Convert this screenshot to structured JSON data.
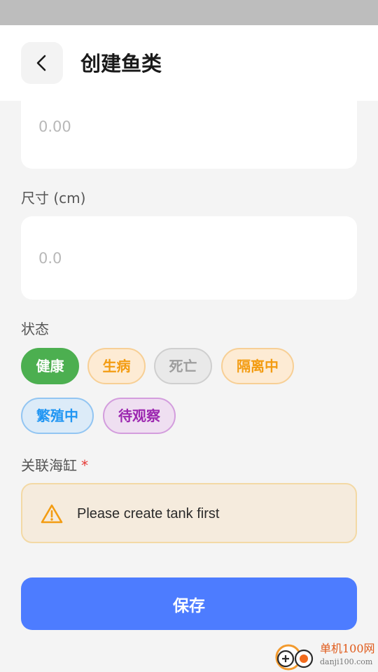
{
  "header": {
    "title": "创建鱼类"
  },
  "weight_field": {
    "placeholder": "0.00"
  },
  "size_field": {
    "label": "尺寸 (cm)",
    "placeholder": "0.0"
  },
  "status": {
    "label": "状态",
    "options": [
      {
        "label": "健康",
        "selected": true,
        "color": "#4caf50"
      },
      {
        "label": "生病",
        "selected": false,
        "color": "#f39c12"
      },
      {
        "label": "死亡",
        "selected": false,
        "color": "#9e9e9e"
      },
      {
        "label": "隔离中",
        "selected": false,
        "color": "#f39c12"
      },
      {
        "label": "繁殖中",
        "selected": false,
        "color": "#2196f3"
      },
      {
        "label": "待观察",
        "selected": false,
        "color": "#9c27b0"
      }
    ]
  },
  "tank": {
    "label": "关联海缸",
    "required_mark": "*",
    "warning_text": "Please create tank first",
    "warning_color": "#f39c12"
  },
  "actions": {
    "save_label": "保存",
    "save_color": "#4d7cff"
  },
  "watermark": {
    "site_name": "单机100网",
    "site_url": "danji100.com"
  }
}
